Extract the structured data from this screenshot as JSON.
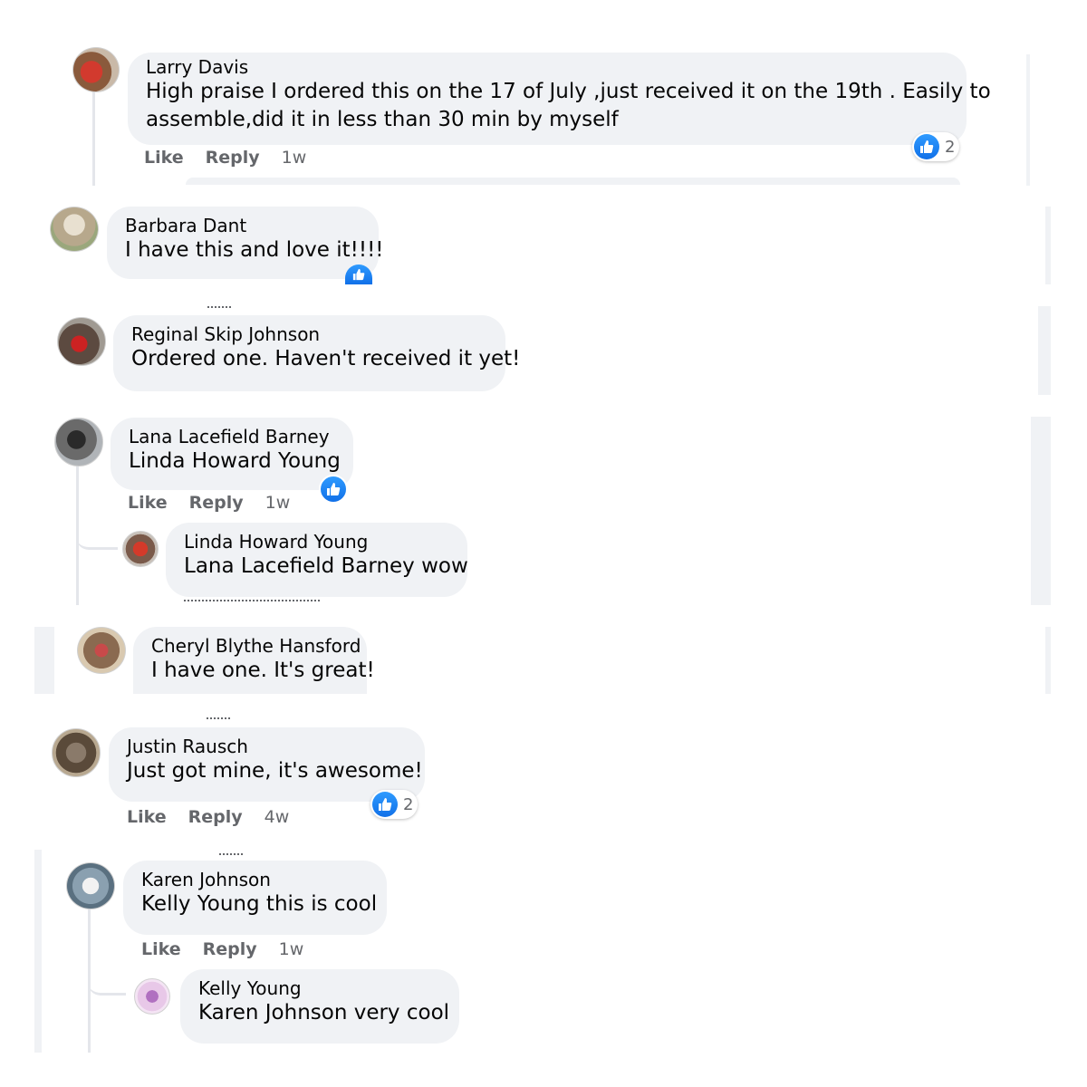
{
  "colors": {
    "bubble": "#f0f2f5",
    "like_blue": "#1877f2",
    "meta_gray": "#65676b"
  },
  "comments": [
    {
      "author": "Larry Davis",
      "text_line1": "High praise I ordered this on the 17 of July ,just received it on the 19th . Easily to",
      "text_line2": "assemble,did it in less than 30 min by myself",
      "actions": {
        "like": "Like",
        "reply": "Reply",
        "time": "1w"
      },
      "reaction_count": "2"
    },
    {
      "author": "Barbara Dant",
      "text": "I have this and love it!!!!"
    },
    {
      "author": "Reginal Skip Johnson",
      "text": "Ordered one. Haven't received it yet!"
    },
    {
      "author": "Lana Lacefield Barney",
      "tag": "Linda Howard Young",
      "actions": {
        "like": "Like",
        "reply": "Reply",
        "time": "1w"
      },
      "reply": {
        "author": "Linda Howard Young",
        "tag": "Lana Lacefield Barney",
        "text": " wow"
      }
    },
    {
      "author": "Cheryl Blythe Hansford",
      "text": "I have one. It's great!"
    },
    {
      "author": "Justin Rausch",
      "text": "Just got mine, it's awesome!",
      "actions": {
        "like": "Like",
        "reply": "Reply",
        "time": "4w"
      },
      "reaction_count": "2"
    },
    {
      "author": "Karen Johnson",
      "tag": "Kelly Young",
      "text": " this is cool",
      "actions": {
        "like": "Like",
        "reply": "Reply",
        "time": "1w"
      },
      "reply": {
        "author": "Kelly Young",
        "tag": "Karen Johnson",
        "text": " very cool"
      }
    }
  ]
}
